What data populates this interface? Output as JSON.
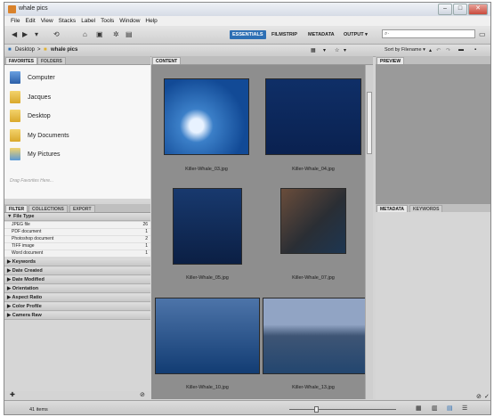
{
  "window": {
    "title": "whale pics"
  },
  "menu": [
    "File",
    "Edit",
    "View",
    "Stacks",
    "Label",
    "Tools",
    "Window",
    "Help"
  ],
  "workspaces": [
    "ESSENTIALS",
    "FILMSTRIP",
    "METADATA",
    "OUTPUT ▾"
  ],
  "search": {
    "placeholder": "⌕·"
  },
  "path": {
    "root": "Desktop",
    "folder": "whale pics"
  },
  "sort": {
    "label": "Sort by Filename ▾"
  },
  "left_top_tabs": [
    "FAVORITES",
    "FOLDERS"
  ],
  "favorites": [
    "Computer",
    "Jacques",
    "Desktop",
    "My Documents",
    "My Pictures"
  ],
  "drag_hint": "Drag Favorites Here...",
  "left_bottom_tabs": [
    "FILTER",
    "COLLECTIONS",
    "EXPORT"
  ],
  "filter": {
    "file_type_label": "▼ File Type",
    "rows": [
      {
        "label": "JPEG file",
        "count": "26"
      },
      {
        "label": "PDF document",
        "count": "1"
      },
      {
        "label": "Photoshop document",
        "count": "2"
      },
      {
        "label": "TIFF image",
        "count": "1"
      },
      {
        "label": "Word document",
        "count": "1"
      }
    ],
    "sections": [
      "▶ Keywords",
      "▶ Date Created",
      "▶ Date Modified",
      "▶ Orientation",
      "▶ Aspect Ratio",
      "▶ Color Profile",
      "▶ Camera Raw"
    ]
  },
  "content": {
    "tab": "CONTENT",
    "thumbs": [
      "Killer-Whale_03.jpg",
      "Killer-Whale_04.jpg",
      "Killer-Whale_05.jpg",
      "Killer-Whale_07.jpg",
      "Killer-Whale_10.jpg",
      "Killer-Whale_13.jpg"
    ]
  },
  "right": {
    "preview_tab": "PREVIEW",
    "metadata_tabs": [
      "METADATA",
      "KEYWORDS"
    ]
  },
  "status": {
    "count": "41 items"
  }
}
